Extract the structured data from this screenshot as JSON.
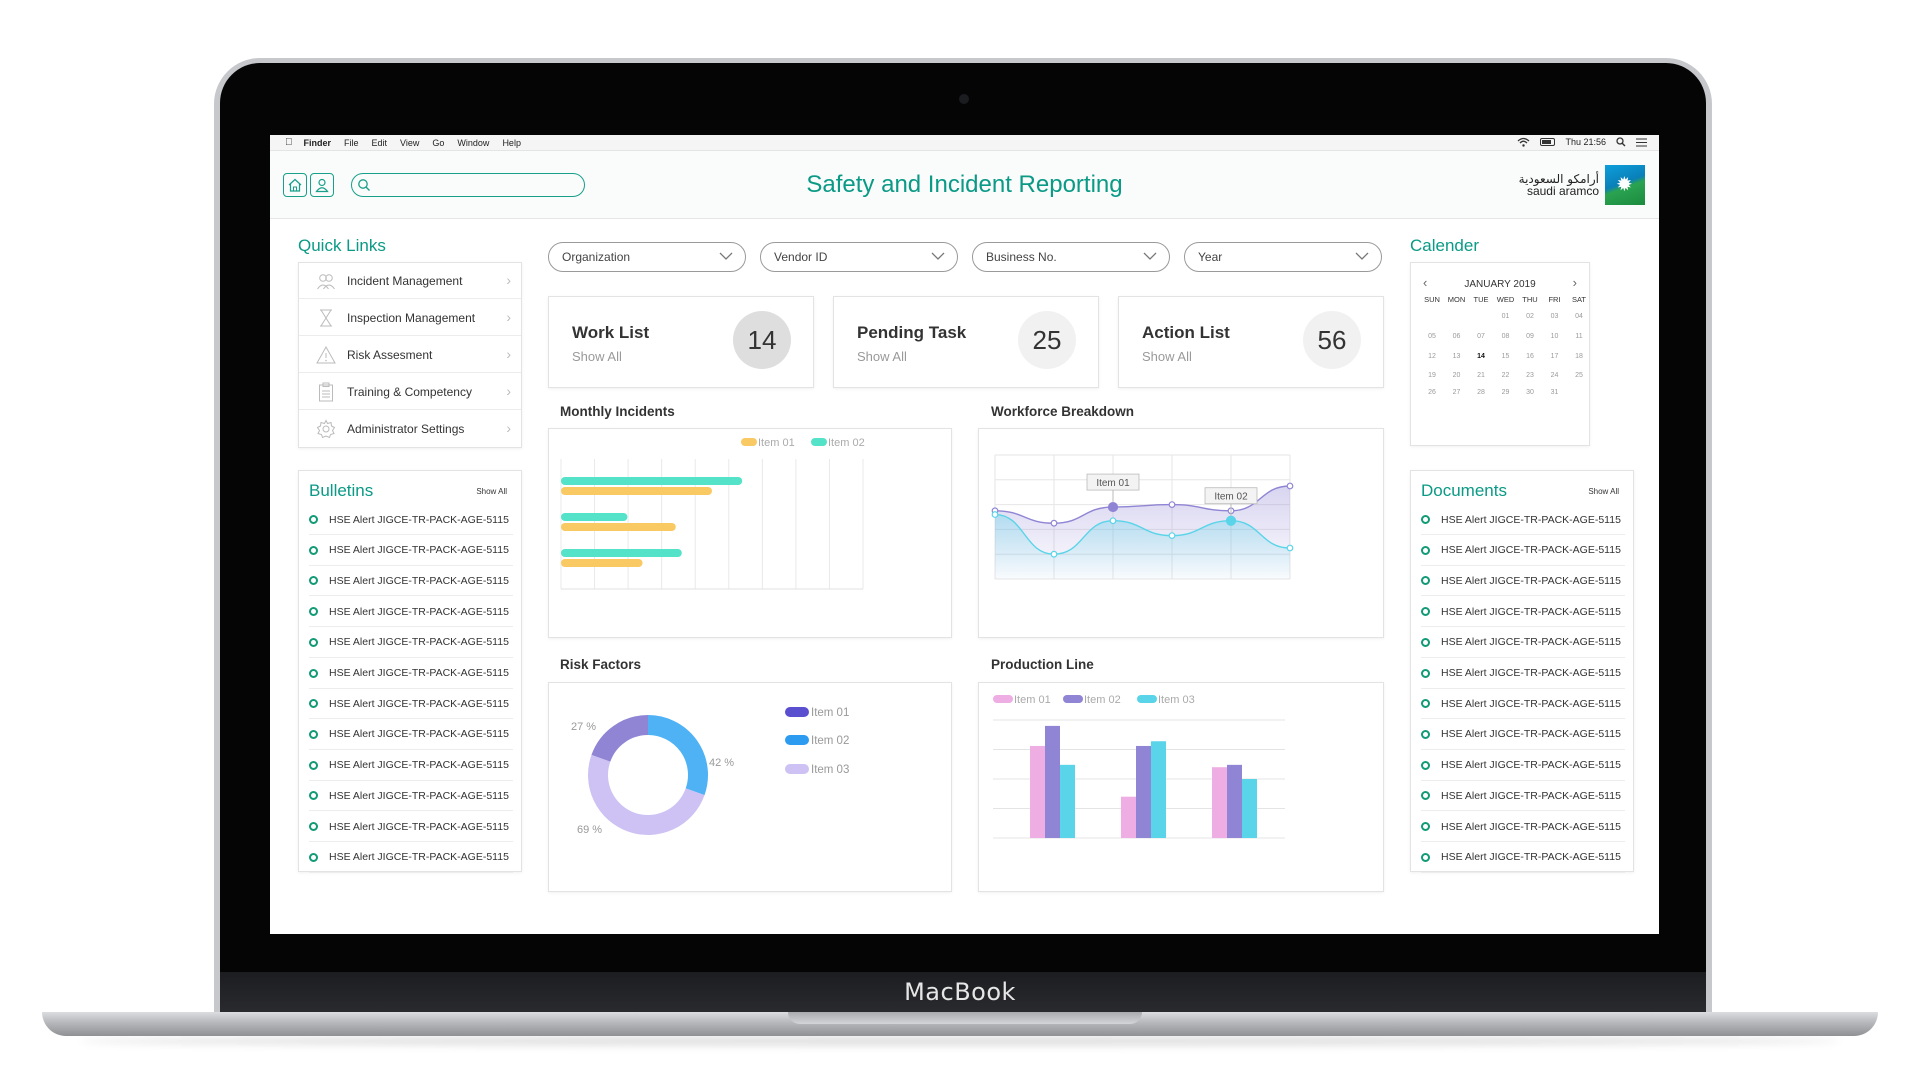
{
  "device": {
    "brand": "MacBook"
  },
  "menubar": {
    "finder": "Finder",
    "items": [
      "File",
      "Edit",
      "View",
      "Go",
      "Window",
      "Help"
    ],
    "clock": "Thu 21:56"
  },
  "header": {
    "title": "Safety and Incident Reporting",
    "search_placeholder": "",
    "logo_arabic": "أرامكو السعودية",
    "logo_english": "saudi aramco"
  },
  "quick_links": {
    "title": "Quick Links",
    "items": [
      {
        "label": "Incident Management",
        "icon": "people-icon"
      },
      {
        "label": "Inspection Management",
        "icon": "hourglass-icon"
      },
      {
        "label": "Risk Assesment",
        "icon": "warning-icon"
      },
      {
        "label": "Training & Competency",
        "icon": "clipboard-icon"
      },
      {
        "label": "Administrator Settings",
        "icon": "gear-icon"
      }
    ]
  },
  "bulletins": {
    "title": "Bulletins",
    "show_all": "Show All",
    "items": [
      "HSE Alert JIGCE-TR-PACK-AGE-5115",
      "HSE Alert JIGCE-TR-PACK-AGE-5115",
      "HSE Alert JIGCE-TR-PACK-AGE-5115",
      "HSE Alert JIGCE-TR-PACK-AGE-5115",
      "HSE Alert JIGCE-TR-PACK-AGE-5115",
      "HSE Alert JIGCE-TR-PACK-AGE-5115",
      "HSE Alert JIGCE-TR-PACK-AGE-5115",
      "HSE Alert JIGCE-TR-PACK-AGE-5115",
      "HSE Alert JIGCE-TR-PACK-AGE-5115",
      "HSE Alert JIGCE-TR-PACK-AGE-5115",
      "HSE Alert JIGCE-TR-PACK-AGE-5115",
      "HSE Alert JIGCE-TR-PACK-AGE-5115"
    ]
  },
  "filters": [
    {
      "label": "Organization"
    },
    {
      "label": "Vendor ID"
    },
    {
      "label": "Business No."
    },
    {
      "label": "Year"
    }
  ],
  "cards": [
    {
      "title": "Work List",
      "sub": "Show All",
      "count": "14"
    },
    {
      "title": "Pending Task",
      "sub": "Show All",
      "count": "25"
    },
    {
      "title": "Action List",
      "sub": "Show All",
      "count": "56"
    }
  ],
  "calendar": {
    "title": "Calender",
    "month": "JANUARY 2019",
    "prev": "‹",
    "next": "›",
    "days_of_week": [
      "SUN",
      "MON",
      "TUE",
      "WED",
      "THU",
      "FRI",
      "SAT"
    ],
    "weeks": [
      [
        "",
        "",
        "",
        "01",
        "02",
        "03",
        "04"
      ],
      [
        "05",
        "06",
        "07",
        "08",
        "09",
        "10",
        "11"
      ],
      [
        "12",
        "13",
        "14",
        "15",
        "16",
        "17",
        "18"
      ],
      [
        "19",
        "20",
        "21",
        "22",
        "23",
        "24",
        "25"
      ],
      [
        "26",
        "27",
        "28",
        "29",
        "30",
        "31",
        ""
      ]
    ],
    "highlighted_day": "14"
  },
  "documents": {
    "title": "Documents",
    "show_all": "Show All",
    "items": [
      "HSE Alert JIGCE-TR-PACK-AGE-5115",
      "HSE Alert JIGCE-TR-PACK-AGE-5115",
      "HSE Alert JIGCE-TR-PACK-AGE-5115",
      "HSE Alert JIGCE-TR-PACK-AGE-5115",
      "HSE Alert JIGCE-TR-PACK-AGE-5115",
      "HSE Alert JIGCE-TR-PACK-AGE-5115",
      "HSE Alert JIGCE-TR-PACK-AGE-5115",
      "HSE Alert JIGCE-TR-PACK-AGE-5115",
      "HSE Alert JIGCE-TR-PACK-AGE-5115",
      "HSE Alert JIGCE-TR-PACK-AGE-5115",
      "HSE Alert JIGCE-TR-PACK-AGE-5115",
      "HSE Alert JIGCE-TR-PACK-AGE-5115"
    ]
  },
  "colors": {
    "accent": "#0a9a86",
    "yellow": "#f9c963",
    "teal": "#54e3c9",
    "purple": "#8f85d4",
    "cyan": "#5ad4e8",
    "pink": "#eeaee3",
    "blue": "#4fb2f5",
    "lavender": "#cdc2f3",
    "indigo": "#5a4fcf"
  },
  "chart_data": [
    {
      "title": "Monthly Incidents",
      "type": "bar",
      "orientation": "horizontal",
      "legend_position": "top-right",
      "categories": [
        "",
        "",
        ""
      ],
      "series": [
        {
          "name": "Item 01",
          "color": "#f9c963",
          "values": [
            50,
            38,
            27
          ]
        },
        {
          "name": "Item 02",
          "color": "#54e3c9",
          "values": [
            60,
            22,
            40
          ]
        }
      ],
      "xlim": [
        0,
        100
      ],
      "grid": true
    },
    {
      "title": "Workforce Breakdown",
      "type": "line",
      "smooth": true,
      "grid": true,
      "x": [
        0,
        1,
        2,
        3,
        4,
        5
      ],
      "ylim": [
        0,
        100
      ],
      "series": [
        {
          "name": "Item 01",
          "color": "#8f85d4",
          "values": [
            55,
            45,
            58,
            60,
            55,
            75
          ]
        },
        {
          "name": "Item 02",
          "color": "#5ad4e8",
          "values": [
            52,
            20,
            47,
            35,
            47,
            25
          ]
        }
      ],
      "annotations": [
        {
          "text": "Item 01",
          "series": 0,
          "x": 2
        },
        {
          "text": "Item 02",
          "series": 1,
          "x": 4
        }
      ]
    },
    {
      "title": "Risk Factors",
      "type": "pie",
      "donut": true,
      "legend_position": "right",
      "slices": [
        {
          "name": "Item 01",
          "value": 27,
          "label": "27 %",
          "color": "#8f85d4"
        },
        {
          "name": "Item 02",
          "value": 42,
          "label": "42 %",
          "color": "#4fb2f5"
        },
        {
          "name": "Item 03",
          "value": 69,
          "label": "69 %",
          "color": "#cdc2f3"
        }
      ],
      "legend_colors": [
        "#5a4fcf",
        "#2d9bf0",
        "#cdc2f3"
      ]
    },
    {
      "title": "Production Line",
      "type": "bar",
      "legend_position": "top-left",
      "categories": [
        "",
        "",
        ""
      ],
      "ylim": [
        0,
        100
      ],
      "grid": true,
      "series": [
        {
          "name": "Item 01",
          "color": "#eeaee3",
          "values": [
            78,
            35,
            60
          ]
        },
        {
          "name": "Item 02",
          "color": "#8f85d4",
          "values": [
            95,
            78,
            62
          ]
        },
        {
          "name": "Item 03",
          "color": "#5ad4e8",
          "values": [
            62,
            82,
            50
          ]
        }
      ]
    }
  ]
}
